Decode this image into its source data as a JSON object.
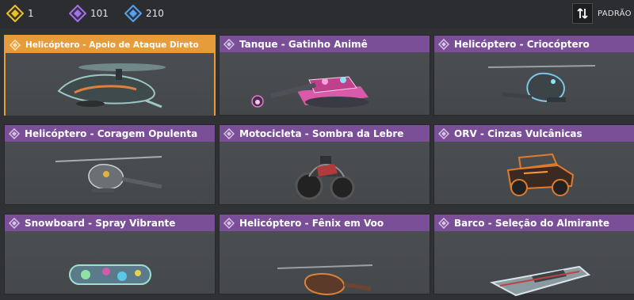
{
  "currencies": [
    {
      "icon": "gold-diamond-icon",
      "amount": "1",
      "color": "#e8c22c"
    },
    {
      "icon": "purple-diamond-icon",
      "amount": "101",
      "color": "#a073e8"
    },
    {
      "icon": "blue-diamond-icon",
      "amount": "210",
      "color": "#5aa0e8"
    }
  ],
  "filter": {
    "label": "PADRÃO",
    "icon": "sort-icon"
  },
  "colors": {
    "selected": "#e79c3c",
    "header": "#7a4f97",
    "card_bg": "#45484b"
  },
  "cards": [
    {
      "title": "Helicóptero - Apoio de Ataque Direto",
      "vehicle": "helicopter",
      "selected": true
    },
    {
      "title": "Tanque - Gatinho Animê",
      "vehicle": "tank",
      "selected": false
    },
    {
      "title": "Helicóptero - Criocóptero",
      "vehicle": "helicopter",
      "selected": false
    },
    {
      "title": "Helicóptero - Coragem Opulenta",
      "vehicle": "helicopter",
      "selected": false
    },
    {
      "title": "Motocicleta - Sombra da Lebre",
      "vehicle": "motorcycle",
      "selected": false
    },
    {
      "title": "ORV - Cinzas Vulcânicas",
      "vehicle": "orv",
      "selected": false
    },
    {
      "title": "Snowboard - Spray Vibrante",
      "vehicle": "snowboard",
      "selected": false
    },
    {
      "title": "Helicóptero - Fênix em Voo",
      "vehicle": "helicopter",
      "selected": false
    },
    {
      "title": "Barco - Seleção do Almirante",
      "vehicle": "boat",
      "selected": false
    }
  ]
}
